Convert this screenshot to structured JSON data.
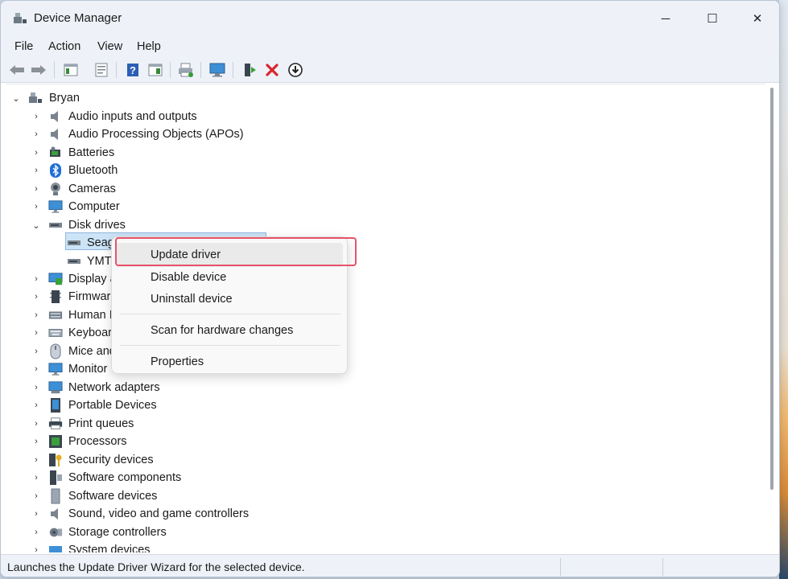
{
  "window": {
    "title": "Device Manager",
    "controls": {
      "minimize": "─",
      "maximize": "☐",
      "close": "✕"
    }
  },
  "menu": [
    "File",
    "Action",
    "View",
    "Help"
  ],
  "toolbar": {
    "icons": [
      "back-icon",
      "forward-icon",
      "show-hide-console-tree-icon",
      "properties-icon",
      "help-icon",
      "show-hide-action-pane-icon",
      "print-icon",
      "scan-hardware-icon",
      "update-driver-icon",
      "uninstall-icon",
      "disable-icon"
    ]
  },
  "tree": {
    "root": "Bryan",
    "categories": [
      {
        "label": "Audio inputs and outputs",
        "icon": "speaker-icon"
      },
      {
        "label": "Audio Processing Objects (APOs)",
        "icon": "speaker-icon"
      },
      {
        "label": "Batteries",
        "icon": "battery-icon"
      },
      {
        "label": "Bluetooth",
        "icon": "bluetooth-icon"
      },
      {
        "label": "Cameras",
        "icon": "camera-icon"
      },
      {
        "label": "Computer",
        "icon": "monitor-icon"
      },
      {
        "label": "Disk drives",
        "icon": "drive-icon",
        "expanded": true
      },
      {
        "label": "Display a",
        "icon": "display-adapter-icon"
      },
      {
        "label": "Firmware",
        "icon": "firmware-icon"
      },
      {
        "label": "Human I",
        "icon": "hid-icon"
      },
      {
        "label": "Keyboar",
        "icon": "keyboard-icon"
      },
      {
        "label": "Mice and",
        "icon": "mouse-icon"
      },
      {
        "label": "Monitor",
        "icon": "monitor-icon"
      },
      {
        "label": "Network adapters",
        "icon": "network-icon"
      },
      {
        "label": "Portable Devices",
        "icon": "portable-device-icon"
      },
      {
        "label": "Print queues",
        "icon": "printer-icon"
      },
      {
        "label": "Processors",
        "icon": "processor-icon"
      },
      {
        "label": "Security devices",
        "icon": "security-icon"
      },
      {
        "label": "Software components",
        "icon": "software-component-icon"
      },
      {
        "label": "Software devices",
        "icon": "software-device-icon"
      },
      {
        "label": "Sound, video and game controllers",
        "icon": "speaker-icon"
      },
      {
        "label": "Storage controllers",
        "icon": "storage-icon"
      },
      {
        "label": "System devices",
        "icon": "system-icon"
      }
    ],
    "disk_children": [
      {
        "label": "Seag",
        "selected": true
      },
      {
        "label": "YMTC"
      }
    ]
  },
  "context_menu": {
    "items": [
      "Update driver",
      "Disable device",
      "Uninstall device",
      "Scan for hardware changes",
      "Properties"
    ]
  },
  "status": {
    "text": "Launches the Update Driver Wizard for the selected device."
  },
  "colors": {
    "accent": "#0067c0",
    "highlight_border": "#e8526a",
    "selection": "#cde4f7"
  }
}
